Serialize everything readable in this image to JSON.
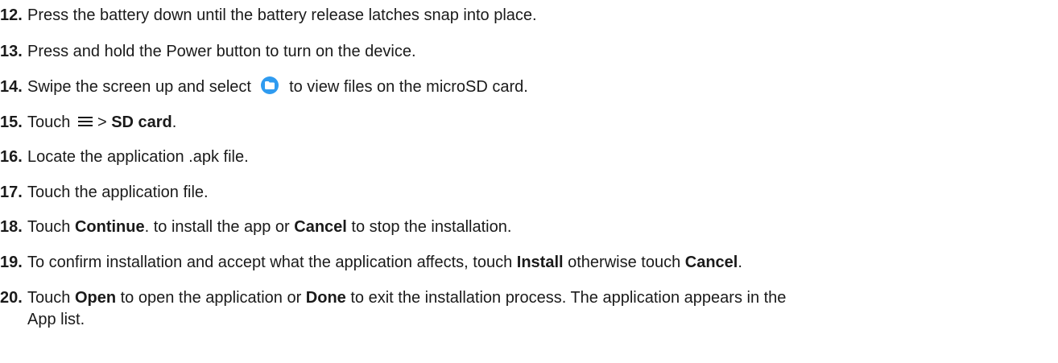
{
  "steps": [
    {
      "num": "12.",
      "text": "Press the battery down until the battery release latches snap into place."
    },
    {
      "num": "13.",
      "text": "Press and hold the Power button to turn on the device."
    },
    {
      "num": "14.",
      "before": "Swipe the screen up and select",
      "icon": "files-folder-icon",
      "after": "to view files on the microSD card."
    },
    {
      "num": "15.",
      "before": "Touch",
      "icon": "menu-icon",
      "mid": "> ",
      "bold": "SD card",
      "after": "."
    },
    {
      "num": "16.",
      "text": "Locate the application .apk file."
    },
    {
      "num": "17.",
      "text": "Touch the application file."
    },
    {
      "num": "18.",
      "before": "Touch ",
      "bold1": "Continue",
      "mid": ". to install the app or ",
      "bold2": "Cancel",
      "after": " to stop the installation."
    },
    {
      "num": "19.",
      "before": "To confirm installation and accept what the application affects, touch ",
      "bold1": "Install",
      "mid": " otherwise touch ",
      "bold2": "Cancel",
      "after": "."
    },
    {
      "num": "20.",
      "before": "Touch ",
      "bold1": "Open",
      "mid": " to open the application or ",
      "bold2": "Done",
      "after": " to exit the installation process. The application appears in the",
      "continuation": "App list."
    }
  ],
  "colors": {
    "text": "#1a1a1a",
    "files_icon": "#2f9bf0"
  }
}
